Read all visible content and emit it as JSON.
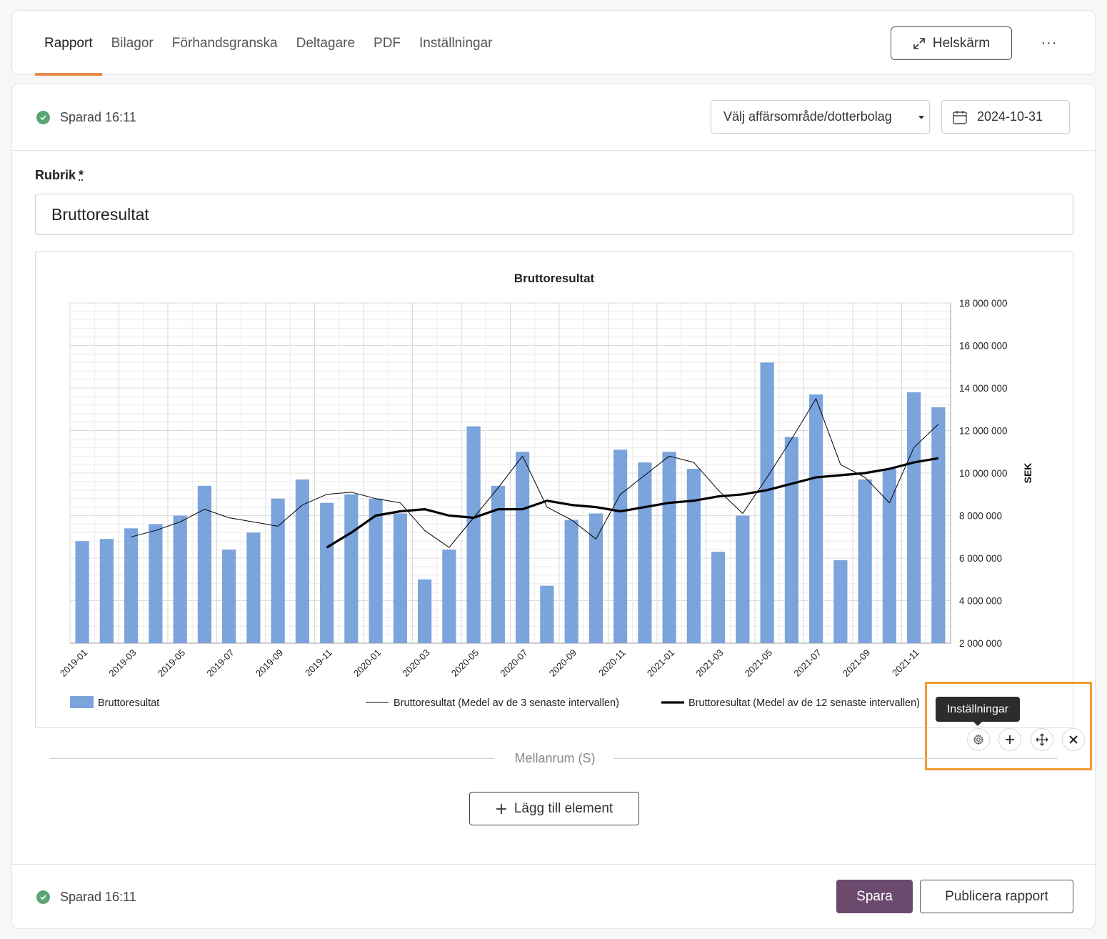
{
  "tabs": [
    "Rapport",
    "Bilagor",
    "Förhandsgranska",
    "Deltagare",
    "PDF",
    "Inställningar"
  ],
  "header_actions": {
    "fullscreen_label": "Helskärm",
    "more_label": "···"
  },
  "status": {
    "saved_text": "Sparad 16:11"
  },
  "filters": {
    "business_area_placeholder": "Välj affärsområde/dotterbolag",
    "date": "2024-10-31"
  },
  "form": {
    "title_label": "Rubrik",
    "required_mark": "*",
    "title_value": "Bruttoresultat"
  },
  "element_toolbar": {
    "tooltip": "Inställningar",
    "icons": [
      "gear-icon",
      "plus-icon",
      "move-icon",
      "close-icon"
    ]
  },
  "spacer": {
    "label": "Mellanrum (S)"
  },
  "add_element_label": "Lägg till element",
  "footer": {
    "save_label": "Spara",
    "publish_label": "Publicera rapport"
  },
  "colors": {
    "accent_tab": "#e98a4d",
    "bar": "#7ba3dc",
    "save_button": "#6b4a6e",
    "highlight": "#f29a2e",
    "saved_check": "#5aa573"
  },
  "chart_data": {
    "type": "bar",
    "title": "Bruttoresultat",
    "ylabel": "SEK",
    "ylim": [
      2000000,
      18000000
    ],
    "yticks": [
      2000000,
      4000000,
      6000000,
      8000000,
      10000000,
      12000000,
      14000000,
      16000000,
      18000000
    ],
    "ytick_labels": [
      "2 000 000",
      "4 000 000",
      "6 000 000",
      "8 000 000",
      "10 000 000",
      "12 000 000",
      "14 000 000",
      "16 000 000",
      "18 000 000"
    ],
    "y_axis_side": "right",
    "grid": true,
    "legend_position": "bottom",
    "x": [
      "2019-01",
      "2019-02",
      "2019-03",
      "2019-04",
      "2019-05",
      "2019-06",
      "2019-07",
      "2019-08",
      "2019-09",
      "2019-10",
      "2019-11",
      "2019-12",
      "2020-01",
      "2020-02",
      "2020-03",
      "2020-04",
      "2020-05",
      "2020-06",
      "2020-07",
      "2020-08",
      "2020-09",
      "2020-10",
      "2020-11",
      "2020-12",
      "2021-01",
      "2021-02",
      "2021-03",
      "2021-04",
      "2021-05",
      "2021-06",
      "2021-07",
      "2021-08",
      "2021-09",
      "2021-10",
      "2021-11",
      "2021-12"
    ],
    "x_tick_labels": [
      "2019-01",
      "2019-03",
      "2019-05",
      "2019-07",
      "2019-09",
      "2019-11",
      "2020-01",
      "2020-03",
      "2020-05",
      "2020-07",
      "2020-09",
      "2020-11",
      "2021-01",
      "2021-03",
      "2021-05",
      "2021-07",
      "2021-09",
      "2021-11"
    ],
    "series": [
      {
        "name": "Bruttoresultat",
        "kind": "bar",
        "values": [
          6800000,
          6900000,
          7400000,
          7600000,
          8000000,
          9400000,
          6400000,
          7200000,
          8800000,
          9700000,
          8600000,
          9000000,
          8800000,
          8100000,
          5000000,
          6400000,
          12200000,
          9400000,
          11000000,
          4700000,
          7800000,
          8100000,
          11100000,
          10500000,
          11000000,
          10200000,
          6300000,
          8000000,
          15200000,
          11700000,
          13700000,
          5900000,
          9700000,
          10200000,
          13800000,
          13100000
        ]
      },
      {
        "name": "Bruttoresultat (Medel av de 3 senaste intervallen)",
        "kind": "line",
        "line_width": "thin",
        "values": [
          null,
          null,
          7000000,
          7300000,
          7700000,
          8300000,
          7900000,
          7700000,
          7500000,
          8500000,
          9000000,
          9100000,
          8800000,
          8600000,
          7300000,
          6500000,
          7900000,
          9300000,
          10800000,
          8400000,
          7800000,
          6900000,
          9000000,
          9900000,
          10800000,
          10500000,
          9200000,
          8100000,
          9800000,
          11600000,
          13500000,
          10400000,
          9800000,
          8600000,
          11200000,
          12300000
        ]
      },
      {
        "name": "Bruttoresultat (Medel av de 12 senaste intervallen)",
        "kind": "line",
        "line_width": "thick",
        "values": [
          null,
          null,
          null,
          null,
          null,
          null,
          null,
          null,
          null,
          null,
          6500000,
          7200000,
          8000000,
          8200000,
          8300000,
          8000000,
          7900000,
          8300000,
          8300000,
          8700000,
          8500000,
          8400000,
          8200000,
          8400000,
          8600000,
          8700000,
          8900000,
          9000000,
          9200000,
          9500000,
          9800000,
          9900000,
          10000000,
          10200000,
          10500000,
          10700000
        ]
      }
    ]
  }
}
